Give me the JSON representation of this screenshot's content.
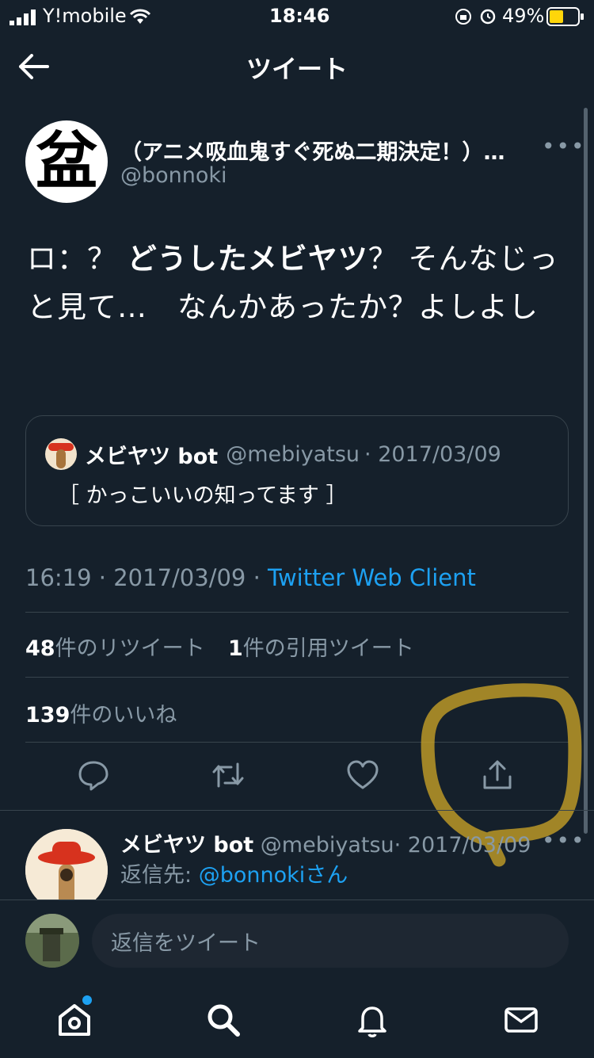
{
  "status_bar": {
    "carrier": "Y!mobile",
    "time": "18:46",
    "battery": "49%"
  },
  "header": {
    "title": "ツイート"
  },
  "tweet": {
    "display_name": "（アニメ吸血鬼すぐ死ぬ二期決定！）…",
    "handle": "@bonnoki",
    "avatar_glyph": "盆",
    "text_prefix": "ロ：？ ",
    "text_bold": "どうしたメビヤツ",
    "text_suffix": "？ そんなじっと見て…　なんかあったか？よしよし",
    "quoted": {
      "name": "メビヤツ bot",
      "handle": "@mebiyatsu",
      "date": "· 2017/03/09",
      "text": "［ かっこいいの知ってます ］"
    },
    "meta_time": "16:19 · 2017/03/09 · ",
    "meta_client": "Twitter Web Client",
    "retweets_count": "48",
    "retweets_label": "件のリツイート",
    "quotes_count": "1",
    "quotes_label": "件の引用ツイート",
    "likes_count": "139",
    "likes_label": "件のいいね"
  },
  "reply": {
    "name": "メビヤツ bot",
    "handle": "@mebiyatsu",
    "date": "· 2017/03/09",
    "reply_to_label": "返信先: ",
    "reply_to_handle": "@bonnoki",
    "reply_to_suffix": "さん"
  },
  "composer": {
    "placeholder": "返信をツイート"
  },
  "colors": {
    "background": "#15202b",
    "accent": "#1da1f2",
    "muted": "#8899a6",
    "highlight": "#c9a227"
  }
}
